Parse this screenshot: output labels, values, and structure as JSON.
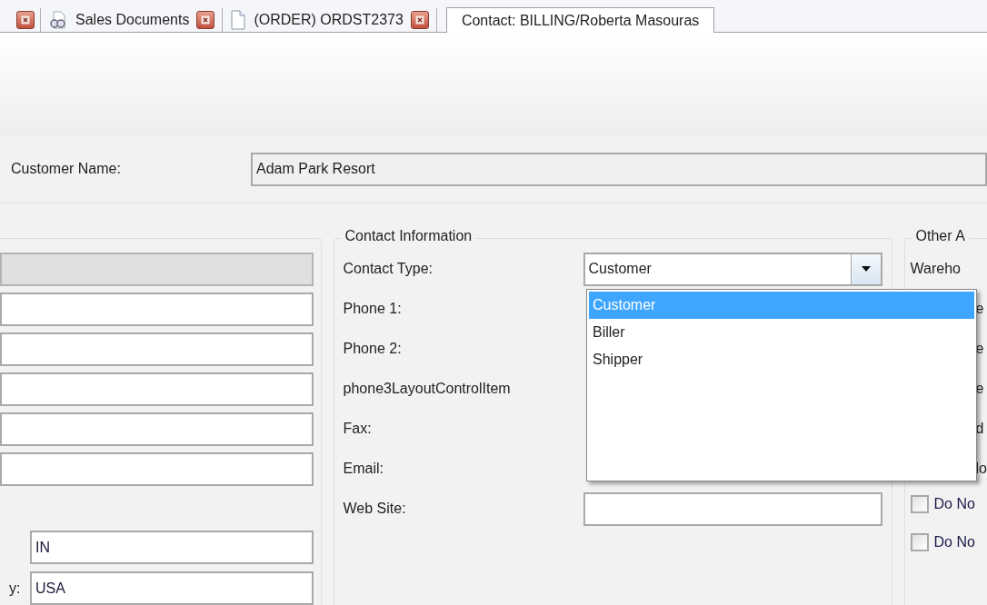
{
  "tabs": [
    {
      "label": "Sales Documents",
      "kind": "search",
      "selected": false
    },
    {
      "label": "(ORDER) ORDST2373",
      "kind": "document",
      "selected": false
    },
    {
      "label": "Contact: BILLING/Roberta Masouras",
      "kind": "plain",
      "selected": true
    }
  ],
  "customer": {
    "label": "Customer Name:",
    "value": "Adam Park Resort"
  },
  "address": {
    "fields": [
      {
        "disabled": true
      },
      {
        "disabled": false
      },
      {
        "disabled": false
      },
      {
        "disabled": false
      },
      {
        "disabled": false
      },
      {
        "disabled": false
      }
    ],
    "state": {
      "value": "IN"
    },
    "country": {
      "label": "y:",
      "value": "USA"
    }
  },
  "contact": {
    "title": "Contact Information",
    "rows": [
      {
        "label": "Contact Type:",
        "kind": "combo"
      },
      {
        "label": "Phone 1:",
        "kind": "covered"
      },
      {
        "label": "Phone 2:",
        "kind": "covered"
      },
      {
        "label": "phone3LayoutControlItem",
        "kind": "covered"
      },
      {
        "label": "Fax:",
        "kind": "covered"
      },
      {
        "label": "Email:",
        "kind": "covered"
      },
      {
        "label": "Web Site:",
        "kind": "field"
      }
    ],
    "combo": {
      "value": "Customer",
      "expanded": true,
      "options": [
        {
          "label": "Customer",
          "selected": true
        },
        {
          "label": "Biller",
          "selected": false
        },
        {
          "label": "Shipper",
          "selected": false
        }
      ]
    }
  },
  "other": {
    "title": "Other A",
    "labels": [
      {
        "text": "Wareho",
        "kind": "full"
      },
      {
        "text": "e",
        "kind": "covered"
      },
      {
        "text": "e",
        "kind": "covered"
      },
      {
        "text": "e",
        "kind": "covered"
      },
      {
        "text": "d",
        "kind": "covered"
      },
      {
        "text": "lo",
        "kind": "covered"
      }
    ],
    "checkboxes": [
      {
        "label": "Do No",
        "checked": false
      },
      {
        "label": "Do No",
        "checked": false
      }
    ]
  }
}
